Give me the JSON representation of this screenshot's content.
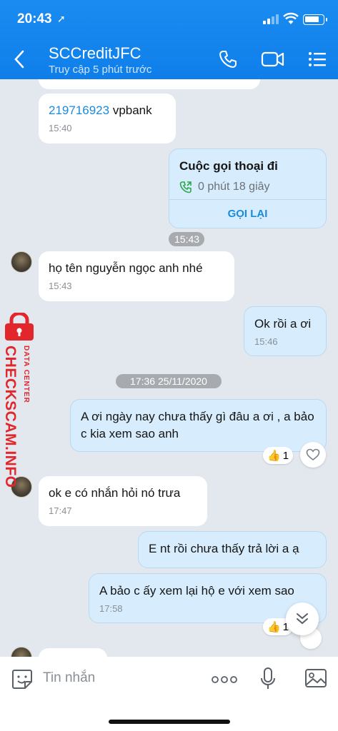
{
  "status": {
    "time": "20:43"
  },
  "header": {
    "title": "SCCreditJFC",
    "subtitle": "Truy cập 5 phút trước"
  },
  "messages": {
    "m1": {
      "link": "219716923",
      "text": " vpbank",
      "time": "15:40"
    },
    "call": {
      "title": "Cuộc gọi thoại đi",
      "duration": "0 phút 18 giây",
      "action": "GỌI LẠI"
    },
    "sep1": "15:43",
    "m2": {
      "text": "họ tên nguyễn ngọc anh nhé",
      "time": "15:43"
    },
    "m3": {
      "text": "Ok rồi a ơi",
      "time": "15:46"
    },
    "sep2": "17:36 25/11/2020",
    "m4": {
      "text": "A ơi ngày nay chưa thấy gì đâu a ơi , a bảo c kia xem sao anh",
      "reaction_count": "1"
    },
    "m5": {
      "text": "ok e có nhắn hỏi nó trưa",
      "time": "17:47"
    },
    "m6": {
      "text": "E nt rồi chưa thấy trả lời a ạ"
    },
    "m7": {
      "text": "A bảo c ấy xem lại hộ e với xem sao",
      "time": "17:58",
      "reaction_count": "1"
    }
  },
  "watermark": {
    "main": "CHECKSCAM.INFO",
    "sub": "DATA CENTER"
  },
  "composer": {
    "placeholder": "Tin nhắn"
  },
  "colors": {
    "header": "#0f7eea",
    "outgoing": "#d7ecfc",
    "incoming": "#ffffff",
    "watermark": "#e1262c"
  }
}
